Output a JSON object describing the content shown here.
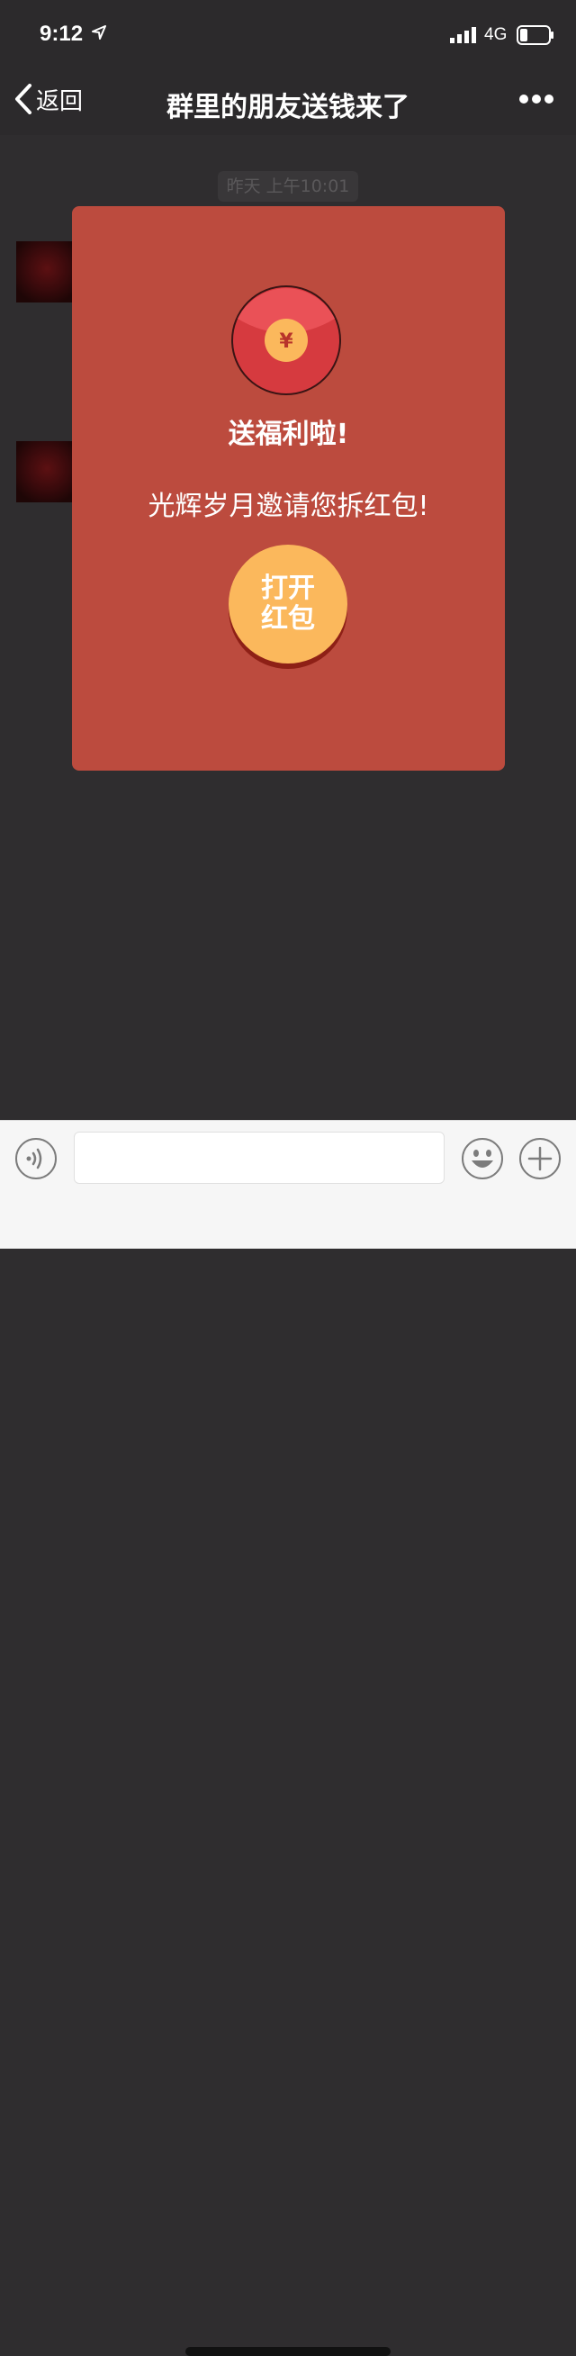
{
  "status_bar": {
    "time": "9:12",
    "network": "4G"
  },
  "nav": {
    "back_label": "返回",
    "title": "群里的朋友送钱来了"
  },
  "chat": {
    "timestamp": "昨天 上午10:01"
  },
  "dialog": {
    "envelope_symbol": "¥",
    "title": "送福利啦!",
    "message": "光辉岁月邀请您拆红包!",
    "open_button_label": "打开红包"
  },
  "input": {
    "placeholder": ""
  },
  "colors": {
    "dialog_bg": "#bc4b3e",
    "button_bg": "#fbb85c",
    "envelope_red": "#d63a3f",
    "coin_gold": "#fbb85c",
    "chat_bg": "#2f2d2f"
  },
  "icons": {
    "back": "chevron-left-icon",
    "more": "more-dots-icon",
    "voice": "voice-icon",
    "emoji": "emoji-icon",
    "plus": "plus-icon"
  }
}
